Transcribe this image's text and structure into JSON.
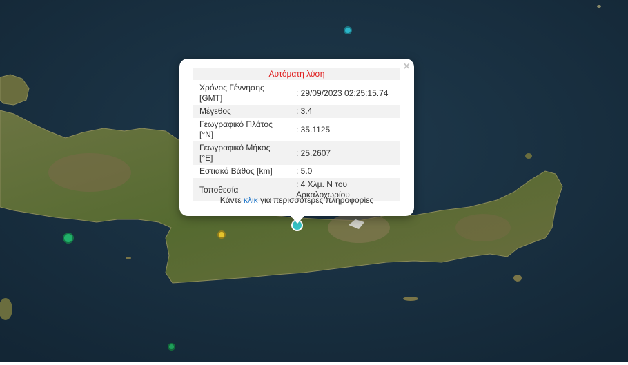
{
  "colors": {
    "sea": "#1a2f3f",
    "land": "#5c6b32",
    "mountain": "#7a6a48",
    "title_red": "#e02020",
    "link_blue": "#1a73c8"
  },
  "map": {
    "markers": [
      {
        "name": "marker-selected",
        "color": "#35c4c6"
      },
      {
        "name": "marker-north",
        "color": "#2bb5c9"
      },
      {
        "name": "marker-west",
        "color": "#21b06a"
      },
      {
        "name": "marker-inland",
        "color": "#e5c42c"
      },
      {
        "name": "marker-south",
        "color": "#1e9e5a"
      }
    ]
  },
  "popup": {
    "close_label": "×",
    "title": "Αυτόματη λύση",
    "rows": [
      {
        "label": "Χρόνος Γέννησης [GMT]",
        "value": ": 29/09/2023 02:25:15.74"
      },
      {
        "label": "Μέγεθος",
        "value": ": 3.4"
      },
      {
        "label": "Γεωγραφικό Πλάτος [°N]",
        "value": ": 35.1125"
      },
      {
        "label": "Γεωγραφικό Μήκος [°E]",
        "value": ": 25.2607"
      },
      {
        "label": "Εστιακό Βάθος [km]",
        "value": ": 5.0"
      },
      {
        "label": "Τοποθεσία",
        "value": ": 4 Χλμ. Ν του Αρκαλοχωρίου"
      }
    ],
    "footer_before": "Κάντε ",
    "footer_link": "κλικ",
    "footer_after": " για περισσότερες πληροφορίες"
  }
}
